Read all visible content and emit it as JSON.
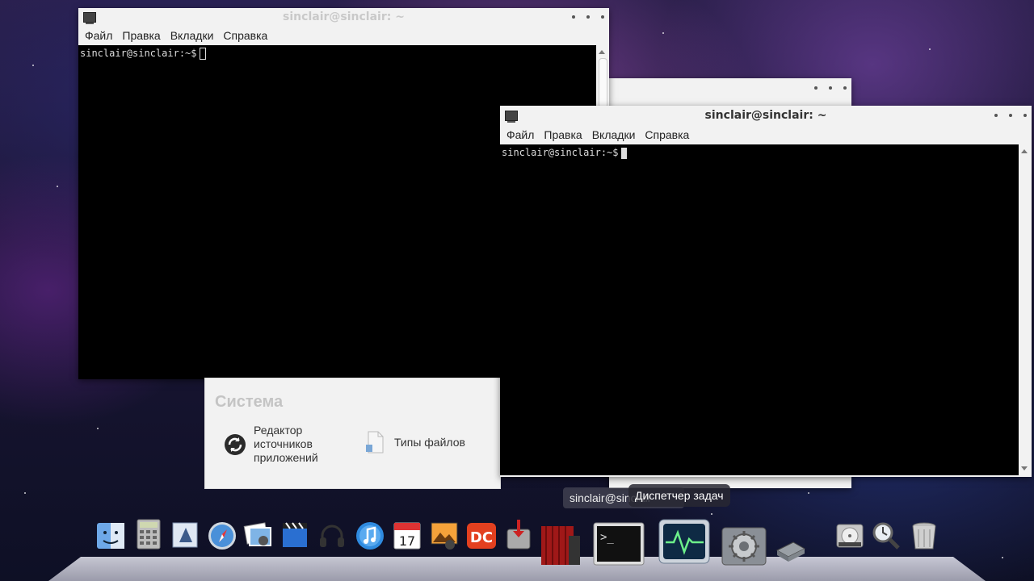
{
  "window_back": {
    "title": "sinclair@sinclair: ~",
    "menu": [
      "Файл",
      "Правка",
      "Вкладки",
      "Справка"
    ],
    "prompt": "sinclair@sinclair:~$"
  },
  "window_front": {
    "title": "sinclair@sinclair: ~",
    "menu": [
      "Файл",
      "Правка",
      "Вкладки",
      "Справка"
    ],
    "prompt": "sinclair@sinclair:~$"
  },
  "system_popup": {
    "heading": "Система",
    "items": [
      {
        "label": "Редактор\nисточников\nприложений",
        "icon": "sync-icon"
      },
      {
        "label": "Типы файлов",
        "icon": "file-types-icon"
      }
    ]
  },
  "taskbar": {
    "window_label": "sinclair@sinclair: ~",
    "tooltip": "Диспетчер задач"
  },
  "dock": {
    "icons": [
      "finder-icon",
      "calculator-icon",
      "mail-icon",
      "safari-icon",
      "photos-icon",
      "video-editor-icon",
      "headphones-icon",
      "itunes-icon",
      "calendar-icon",
      "photo-viewer-icon",
      "docs-icon",
      "app-installer-icon",
      "movie-icon",
      "terminal-icon",
      "system-monitor-icon",
      "settings-icon",
      "drive-icon",
      "disk-icon",
      "search-icon",
      "trash-icon"
    ],
    "calendar_day": "17"
  }
}
